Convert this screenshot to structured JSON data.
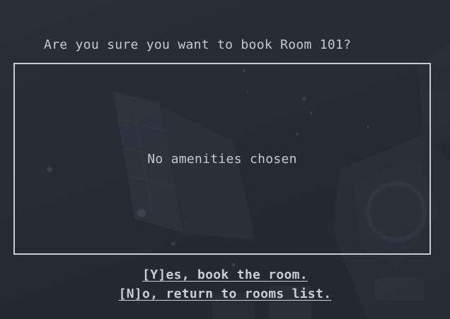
{
  "dialog": {
    "prompt": "Are you sure you want to book Room 101?",
    "amenities_text": "No amenities chosen"
  },
  "actions": {
    "yes_label": "[Y]es, book the room.",
    "no_label": "[N]o, return to rooms list."
  },
  "colors": {
    "background": "#272b35",
    "text": "#c5c9d1",
    "border": "#c7cbd3"
  }
}
